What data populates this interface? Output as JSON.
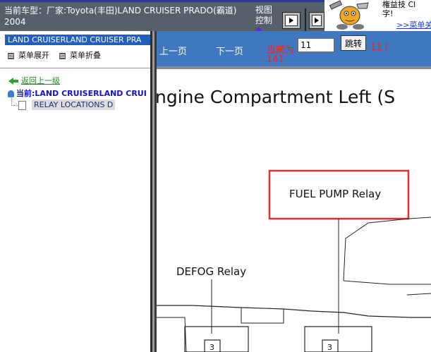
{
  "header": {
    "car_model": "当前车型：厂家:Toyota(丰田)LAND CRUISER PRADO(霸道) 2004",
    "view_control": "视图控制",
    "help_text_line1": "権益技  Cl",
    "help_text_line2": "字!",
    "help_link": ">>菜单关"
  },
  "sidebar": {
    "title": "LAND CRUISERLAND CRUISER PRA",
    "expand_label": "菜单展开",
    "collapse_label": "菜单折叠",
    "back_label": "返回上一级",
    "current_label": "当前:LAND CRUISERLAND CRUI",
    "items": [
      {
        "label": "RELAY LOCATIONS D"
      }
    ]
  },
  "toolbar": {
    "prev_label": "上一页",
    "next_label": "下一页",
    "current_page_label": "当前为",
    "page_input_value": "11",
    "go_label": "跳转",
    "page_total_a": "11 /",
    "page_total_b": "141"
  },
  "diagram": {
    "heading": "ngine Compartment Left (S",
    "fuel_pump_label": "FUEL PUMP Relay",
    "defog_label": "DEFOG Relay",
    "connector_a": "3",
    "connector_b": "3",
    "highlight_color": "#e03030"
  }
}
